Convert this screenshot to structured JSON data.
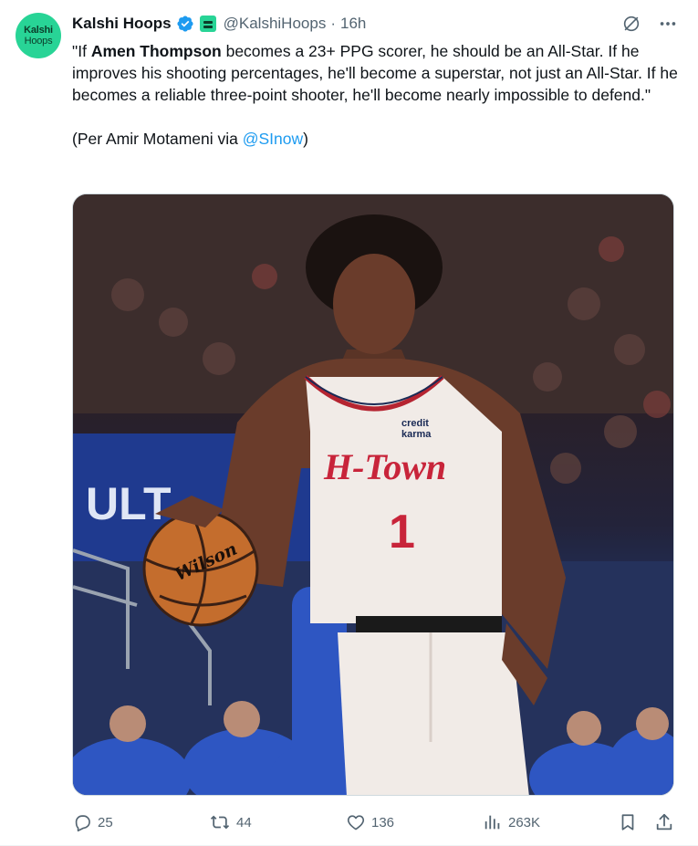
{
  "author": {
    "avatar_line1": "Kalshi",
    "avatar_line2": "Hoops",
    "display_name": "Kalshi Hoops",
    "handle": "@KalshiHoops",
    "separator": "·",
    "time": "16h"
  },
  "tweet": {
    "quote_open": "\"If ",
    "player_name": "Amen Thompson",
    "quote_rest": " becomes a 23+ PPG scorer, he should be an All-Star. If he improves his shooting percentages, he'll become a superstar, not just an All-Star. If he becomes a reliable three-point shooter, he'll become nearly impossible to defend.\"",
    "credit_prefix": "(Per Amir Motameni via ",
    "credit_mention": "@SInow",
    "credit_suffix": ")"
  },
  "actions": {
    "replies": "25",
    "reposts": "44",
    "likes": "136",
    "views": "263K"
  },
  "colors": {
    "accent": "#1d9bf0",
    "brand_green": "#28d496",
    "muted": "#536471"
  },
  "media": {
    "jersey_script": "H-Town",
    "jersey_number": "1",
    "jersey_sponsor_line1": "credit",
    "jersey_sponsor_line2": "karma",
    "ball_brand": "Wilson",
    "banner_text": "ULT"
  }
}
